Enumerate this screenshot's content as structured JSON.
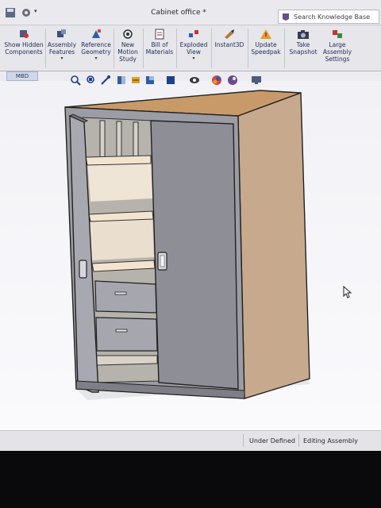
{
  "window": {
    "title": "Cabinet office *"
  },
  "search": {
    "label": "Search Knowledge Base",
    "icon": "knowledge-base-icon"
  },
  "ribbon": {
    "buttons": [
      {
        "label": "Show Hidden Components",
        "icon": "show-hidden-icon"
      },
      {
        "label": "Assembly Features",
        "icon": "assembly-features-icon",
        "dropdown": true
      },
      {
        "label": "Reference Geometry",
        "icon": "reference-geometry-icon",
        "dropdown": true
      },
      {
        "label": "New Motion Study",
        "icon": "motion-study-icon"
      },
      {
        "label": "Bill of Materials",
        "icon": "bom-icon"
      },
      {
        "label": "Exploded View",
        "icon": "exploded-view-icon",
        "dropdown": true
      },
      {
        "label": "Instant3D",
        "icon": "instant3d-icon"
      },
      {
        "label": "Update Speedpak",
        "icon": "speedpak-icon"
      },
      {
        "label": "Take Snapshot",
        "icon": "camera-icon"
      },
      {
        "label": "Large Assembly Settings",
        "icon": "large-assembly-icon"
      }
    ]
  },
  "tabs": {
    "mbd": "MBD"
  },
  "hud_icons": [
    "zoom-to-fit-icon",
    "zoom-to-area-icon",
    "previous-view-icon",
    "section-view-icon",
    "dynamic-annotation-icon",
    "view-orientation-icon",
    "display-style-icon",
    "hide-show-items-icon",
    "edit-appearance-icon",
    "apply-scene-icon",
    "view-settings-icon"
  ],
  "status": {
    "definition": "Under Defined",
    "mode": "Editing Assembly"
  },
  "colors": {
    "ribbon_text": "#1f2b55",
    "cabinet_top": "#c89a6a",
    "cabinet_side": "#c7a98d",
    "door": "#8e8e96",
    "shelf": "#f2e4cf"
  }
}
